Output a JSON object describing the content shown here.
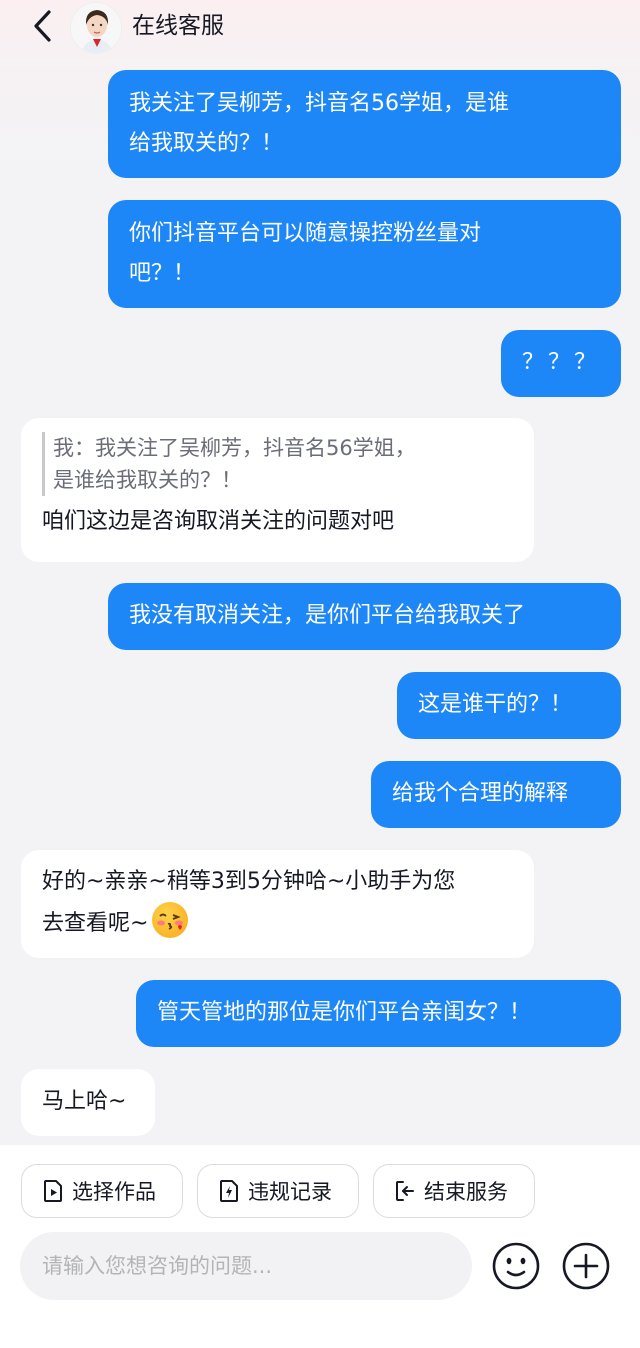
{
  "header": {
    "title": "在线客服"
  },
  "messages": [
    {
      "side": "out",
      "text": "我关注了吴柳芳，抖音名56学姐，是谁\n给我取关的？！"
    },
    {
      "side": "out",
      "text": "你们抖音平台可以随意操控粉丝量对\n吧？！"
    },
    {
      "side": "out",
      "text": "？？？"
    },
    {
      "side": "in",
      "quote": "我：我关注了吴柳芳，抖音名56学姐，\n是谁给我取关的？！",
      "text": "咱们这边是咨询取消关注的问题对吧"
    },
    {
      "side": "out",
      "text": "我没有取消关注，是你们平台给我取关了"
    },
    {
      "side": "out",
      "text": "这是谁干的？！"
    },
    {
      "side": "out",
      "text": "给我个合理的解释"
    },
    {
      "side": "in",
      "text": "好的~亲亲~稍等3到5分钟哈~小助手为您\n去查看呢~",
      "emoji": "blushing-kiss-emoji"
    },
    {
      "side": "out",
      "text": "管天管地的那位是你们平台亲闺女？！"
    },
    {
      "side": "in",
      "text": "马上哈~"
    }
  ],
  "quick_actions": [
    {
      "label": "选择作品",
      "icon": "select-video-icon"
    },
    {
      "label": "违规记录",
      "icon": "violation-record-icon"
    },
    {
      "label": "结束服务",
      "icon": "exit-service-icon"
    }
  ],
  "input": {
    "placeholder": "请输入您想咨询的问题..."
  },
  "icons": {
    "back": "chevron-left-icon",
    "emoji": "emoji-icon",
    "add": "plus-circle-icon"
  },
  "colors": {
    "outgoing_bubble": "#1e87f8",
    "incoming_bubble": "#ffffff",
    "background": "#f3f3f5"
  }
}
